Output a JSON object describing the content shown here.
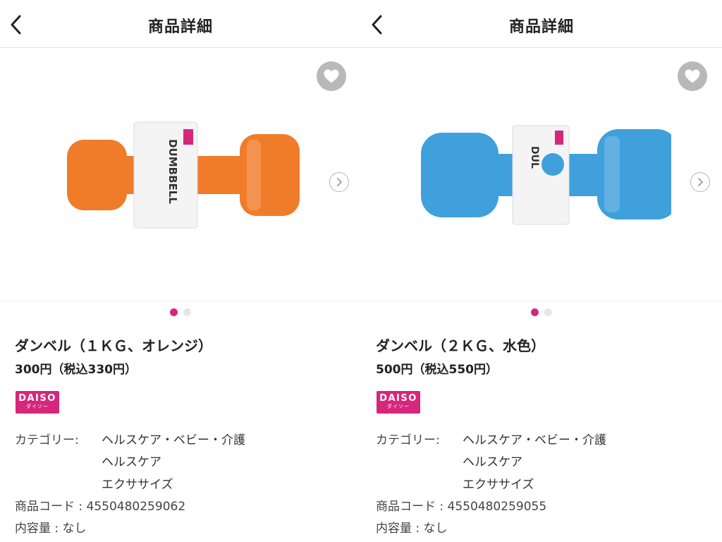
{
  "screens": [
    {
      "header": {
        "title": "商品詳細"
      },
      "product": {
        "name": "ダンベル（１ＫＧ、オレンジ）",
        "price": "300円（税込330円）",
        "image_color": "#f07c2a",
        "label_text": "DUMBBELL"
      },
      "brand": {
        "name": "DAISO",
        "sub": "ダイソー",
        "color": "#d6277c"
      },
      "details": {
        "category_label": "カテゴリー:",
        "categories": [
          "ヘルスケア・ベビー・介護",
          "ヘルスケア",
          "エクササイズ"
        ],
        "code": "商品コード : 4550480259062",
        "content": "内容量 : なし"
      },
      "pagination": {
        "total": 2,
        "current": 1
      }
    },
    {
      "header": {
        "title": "商品詳細"
      },
      "product": {
        "name": "ダンベル（２ＫＧ、水色）",
        "price": "500円（税込550円）",
        "image_color": "#3fa0dc",
        "label_text": "DUL"
      },
      "brand": {
        "name": "DAISO",
        "sub": "ダイソー",
        "color": "#d6277c"
      },
      "details": {
        "category_label": "カテゴリー:",
        "categories": [
          "ヘルスケア・ベビー・介護",
          "ヘルスケア",
          "エクササイズ"
        ],
        "code": "商品コード : 4550480259055",
        "content": "内容量 : なし"
      },
      "pagination": {
        "total": 2,
        "current": 1
      }
    }
  ]
}
